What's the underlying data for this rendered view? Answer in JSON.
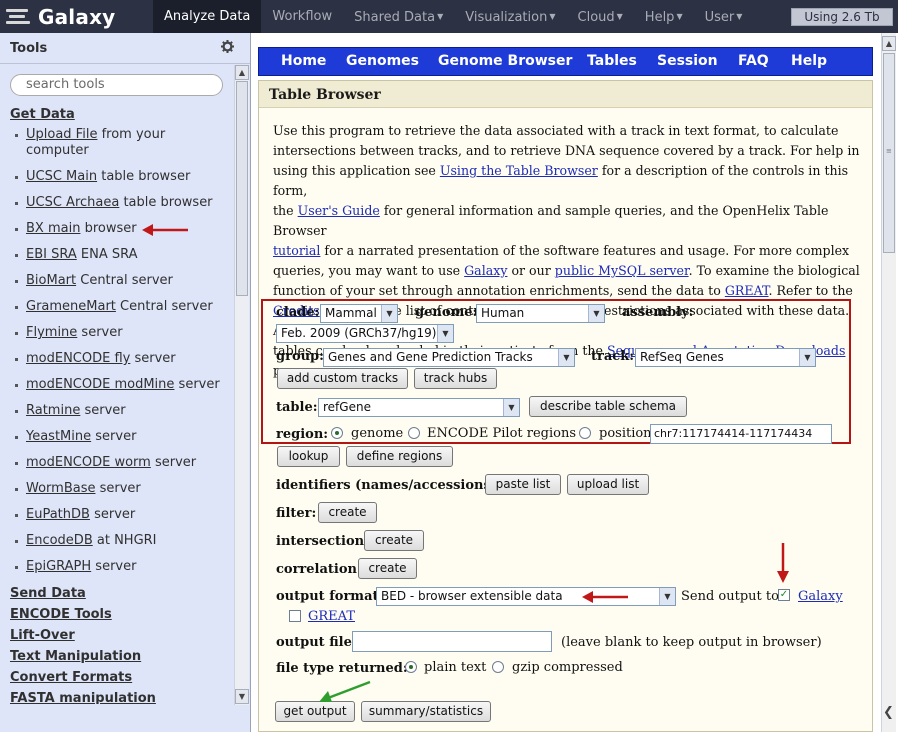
{
  "masthead": {
    "brand": "Galaxy",
    "nav": [
      {
        "label": "Analyze Data",
        "dropdown": false,
        "active": true
      },
      {
        "label": "Workflow",
        "dropdown": false,
        "active": false
      },
      {
        "label": "Shared Data",
        "dropdown": true,
        "active": false
      },
      {
        "label": "Visualization",
        "dropdown": true,
        "active": false
      },
      {
        "label": "Cloud",
        "dropdown": true,
        "active": false
      },
      {
        "label": "Help",
        "dropdown": true,
        "active": false
      },
      {
        "label": "User",
        "dropdown": true,
        "active": false
      }
    ],
    "quota": "Using 2.6 Tb"
  },
  "tools": {
    "title": "Tools",
    "search_placeholder": "search tools",
    "sections_top": [
      "Get Data"
    ],
    "items": [
      {
        "link": "Upload File",
        "rest": " from your",
        "rest2": "computer"
      },
      {
        "link": "UCSC Main",
        "rest": " table browser"
      },
      {
        "link": "UCSC Archaea",
        "rest": " table browser"
      },
      {
        "link": "BX main",
        "rest": " browser"
      },
      {
        "link": "EBI SRA",
        "rest": " ENA SRA"
      },
      {
        "link": "BioMart",
        "rest": " Central server"
      },
      {
        "link": "GrameneMart",
        "rest": " Central server"
      },
      {
        "link": "Flymine",
        "rest": " server"
      },
      {
        "link": "modENCODE fly",
        "rest": " server"
      },
      {
        "link": "modENCODE modMine",
        "rest": " server"
      },
      {
        "link": "Ratmine",
        "rest": " server"
      },
      {
        "link": "YeastMine",
        "rest": " server"
      },
      {
        "link": "modENCODE worm",
        "rest": " server"
      },
      {
        "link": "WormBase",
        "rest": " server"
      },
      {
        "link": "EuPathDB",
        "rest": " server"
      },
      {
        "link": "EncodeDB",
        "rest": " at NHGRI"
      },
      {
        "link": "EpiGRAPH",
        "rest": " server"
      }
    ],
    "sections_bottom": [
      "Send Data",
      "ENCODE Tools",
      "Lift-Over",
      "Text Manipulation",
      "Convert Formats",
      "FASTA manipulation"
    ]
  },
  "ucsc_nav": [
    "Home",
    "Genomes",
    "Genome Browser",
    "Tables",
    "Session",
    "FAQ",
    "Help"
  ],
  "panel": {
    "title": "Table Browser",
    "intro_lines": [
      [
        {
          "t": "Use this program to retrieve the data associated with a track in text format, to calculate"
        }
      ],
      [
        {
          "t": "intersections between tracks, and to retrieve DNA sequence covered by a track. For help in"
        }
      ],
      [
        {
          "t": "using this application see "
        },
        {
          "t": "Using the Table Browser",
          "link": true
        },
        {
          "t": " for a description of the controls in this form,"
        }
      ],
      [
        {
          "t": "the "
        },
        {
          "t": "User's Guide",
          "link": true
        },
        {
          "t": " for general information and sample queries, and the OpenHelix Table Browser"
        }
      ],
      [
        {
          "t": "tutorial",
          "link": true
        },
        {
          "t": " for a narrated presentation of the software features and usage. For more complex"
        }
      ],
      [
        {
          "t": "queries, you may want to use "
        },
        {
          "t": "Galaxy",
          "link": true
        },
        {
          "t": " or our "
        },
        {
          "t": "public MySQL server",
          "link": true
        },
        {
          "t": ". To examine the biological"
        }
      ],
      [
        {
          "t": "function of your set through annotation enrichments, send the data to "
        },
        {
          "t": "GREAT",
          "link": true
        },
        {
          "t": ". Refer to the"
        }
      ],
      [
        {
          "t": "Credits",
          "link": true
        },
        {
          "t": " page for the list of contributors and usage restrictions associated with these data. All"
        }
      ],
      [
        {
          "t": "tables can be downloaded in their entirety from the "
        },
        {
          "t": "Sequence and Annotation Downloads",
          "link": true
        },
        {
          "t": " page."
        }
      ]
    ]
  },
  "form": {
    "clade_label": "clade:",
    "clade_value": "Mammal",
    "genome_label": "genome:",
    "genome_value": "Human",
    "assembly_label": "assembly:",
    "assembly_value": "Feb. 2009 (GRCh37/hg19)",
    "group_label": "group:",
    "group_value": "Genes and Gene Prediction Tracks",
    "track_label": "track:",
    "track_value": "RefSeq Genes",
    "add_custom_tracks": "add custom tracks",
    "track_hubs": "track hubs",
    "table_label": "table:",
    "table_value": "refGene",
    "describe_schema": "describe table schema",
    "region_label": "region:",
    "region_genome": "genome",
    "region_encode": "ENCODE Pilot regions",
    "region_position": "position",
    "position_value": "chr7:117174414-117174434",
    "lookup": "lookup",
    "define_regions": "define regions",
    "identifiers_label": "identifiers (names/accessions):",
    "paste_list": "paste list",
    "upload_list": "upload list",
    "filter_label": "filter:",
    "create": "create",
    "intersection_label": "intersection:",
    "correlation_label": "correlation:",
    "output_format_label": "output format:",
    "output_format_value": "BED - browser extensible data",
    "send_output_to": "Send output to",
    "galaxy": "Galaxy",
    "great": "GREAT",
    "output_file_label": "output file:",
    "output_file_value": "",
    "output_file_hint": "(leave blank to keep output in browser)",
    "file_type_label": "file type returned:",
    "plain_text": "plain text",
    "gzip": "gzip compressed",
    "get_output": "get output",
    "summary_statistics": "summary/statistics"
  },
  "colors": {
    "masthead": "#2c3143",
    "tool_panel": "#dfe5f9",
    "ucsc_nav": "#1e3bd8",
    "highlight_box": "#b31515",
    "red_arrow": "#c01818",
    "green_arrow": "#2f9e2f"
  }
}
